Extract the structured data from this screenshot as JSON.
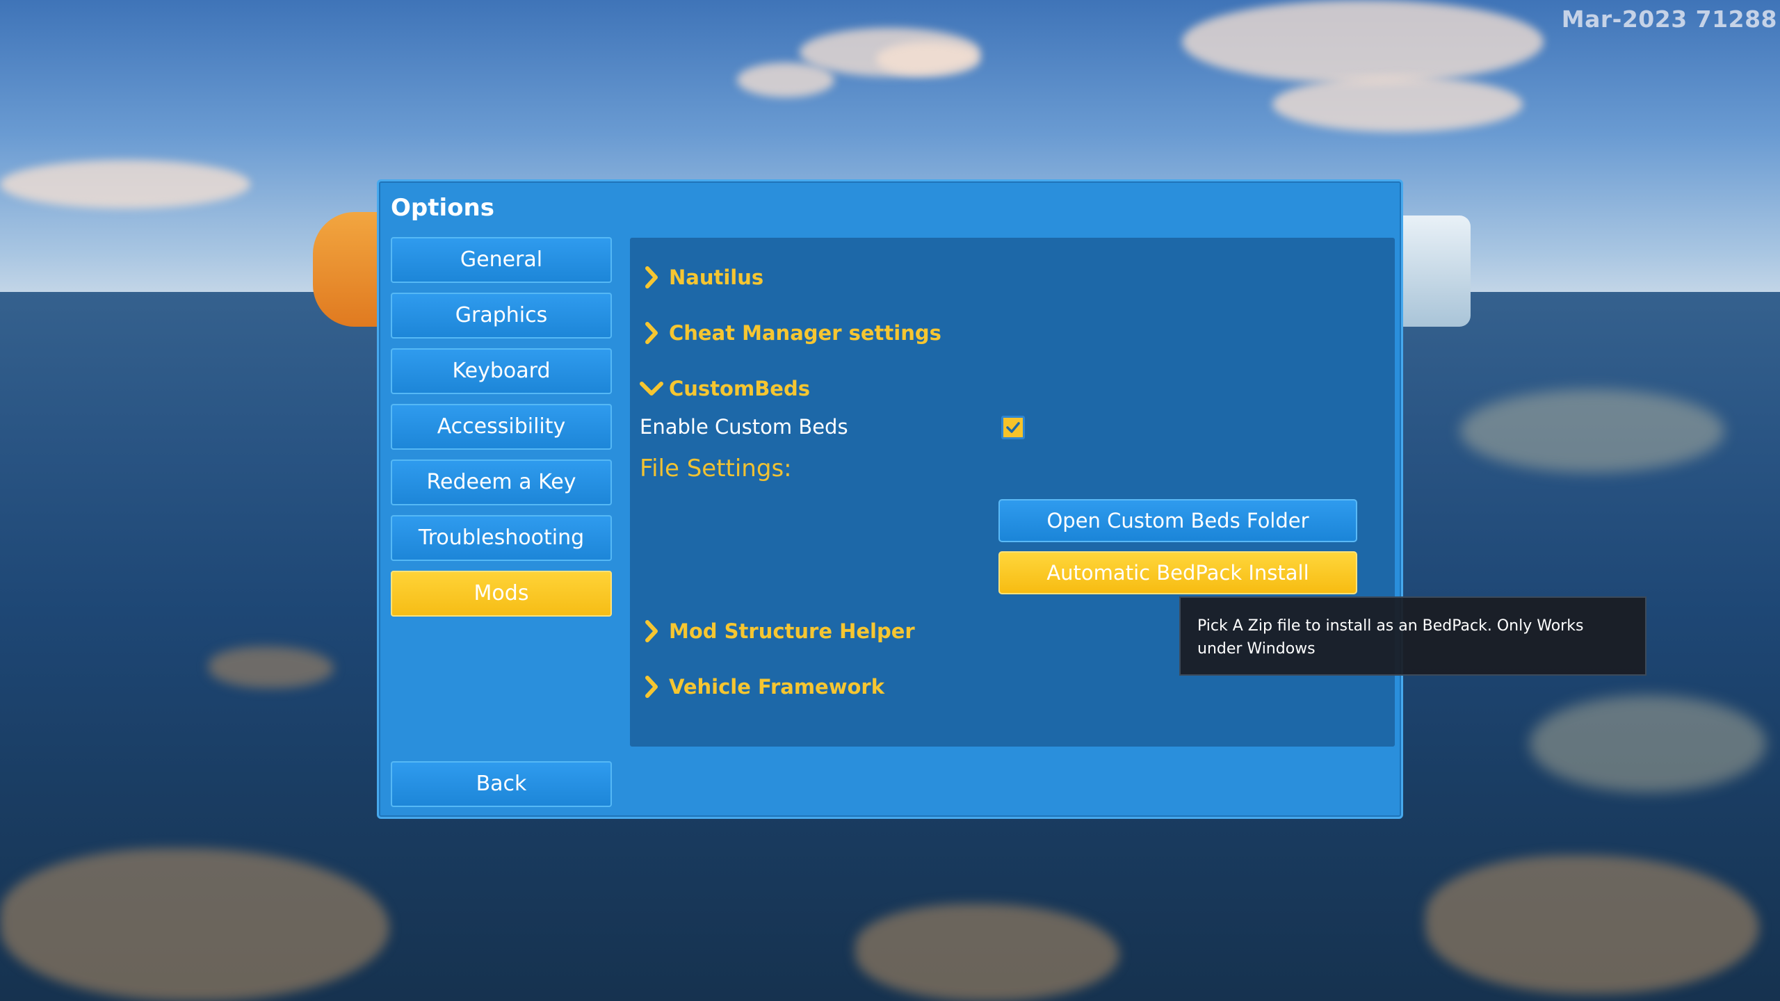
{
  "watermark": "Mar-2023 71288",
  "options": {
    "title": "Options",
    "nav": [
      {
        "label": "General"
      },
      {
        "label": "Graphics"
      },
      {
        "label": "Keyboard"
      },
      {
        "label": "Accessibility"
      },
      {
        "label": "Redeem a Key"
      },
      {
        "label": "Troubleshooting"
      },
      {
        "label": "Mods",
        "active": true
      }
    ],
    "back_label": "Back"
  },
  "mods": {
    "sections": [
      {
        "label": "Nautilus",
        "expanded": false
      },
      {
        "label": "Cheat Manager settings",
        "expanded": false
      },
      {
        "label": "CustomBeds",
        "expanded": true
      },
      {
        "label": "Mod Structure Helper",
        "expanded": false
      },
      {
        "label": "Vehicle Framework",
        "expanded": false
      }
    ],
    "custombeds": {
      "enable_label": "Enable Custom Beds",
      "enable_checked": true,
      "file_settings_label": "File Settings:",
      "open_folder_label": "Open Custom Beds Folder",
      "auto_install_label": "Automatic BedPack Install"
    }
  },
  "tooltip": {
    "text": "Pick A Zip file to install as an BedPack. Only Works under Windows"
  },
  "colors": {
    "window_blue": "#2a8fdc",
    "panel_blue": "#1d68a8",
    "accent_yellow": "#f6c631",
    "active_yellow": "#ffd337"
  }
}
